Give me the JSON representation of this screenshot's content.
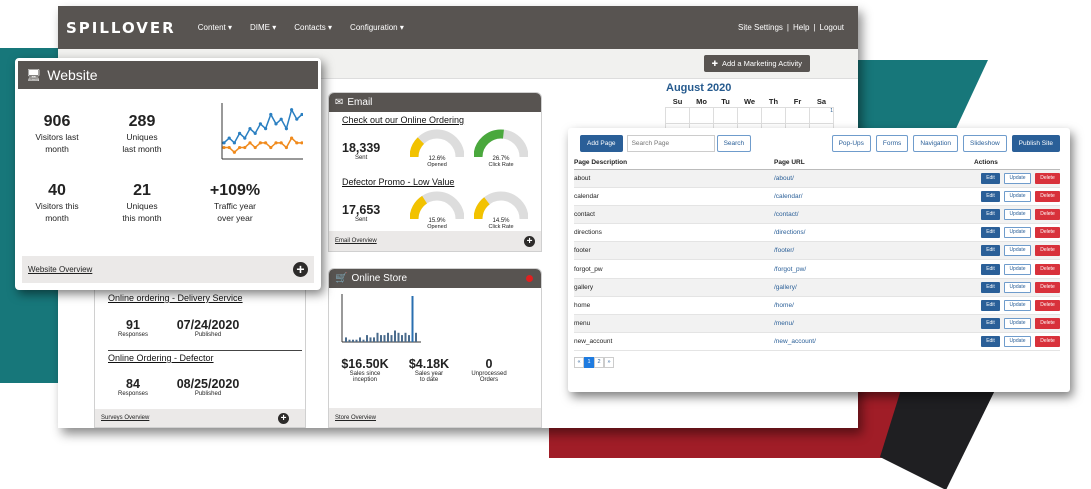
{
  "header": {
    "logo": "SPILLOVER",
    "nav": [
      "Content ▾",
      "DIME ▾",
      "Contacts ▾",
      "Configuration ▾"
    ],
    "right_links": [
      "Site Settings",
      "|",
      "Help",
      "|",
      "Logout"
    ],
    "add_marketing_label": "Add a Marketing Activity"
  },
  "calendar": {
    "title": "August 2020",
    "days": [
      "Su",
      "Mo",
      "Tu",
      "We",
      "Th",
      "Fr",
      "Sa"
    ],
    "first_date": "1"
  },
  "email": {
    "title": "Email",
    "campaigns": [
      {
        "name": "Check out our Online Ordering",
        "sent": "18,339",
        "sent_label": "Sent",
        "opened": "12.6%",
        "opened_label": "Opened",
        "opened_value": 12.6,
        "click": "26.7%",
        "click_label": "Click Rate",
        "click_value": 26.7
      },
      {
        "name": "Defector Promo - Low Value",
        "sent": "17,653",
        "sent_label": "Sent",
        "opened": "15.9%",
        "opened_label": "Opened",
        "opened_value": 15.9,
        "click": "14.5%",
        "click_label": "Click Rate",
        "click_value": 14.5
      }
    ],
    "footer_link": "Email Overview"
  },
  "store": {
    "title": "Online Store",
    "stats": [
      {
        "value": "$16.50K",
        "label1": "Sales since",
        "label2": "inception"
      },
      {
        "value": "$4.18K",
        "label1": "Sales year",
        "label2": "to date"
      },
      {
        "value": "0",
        "label1": "Unprocessed",
        "label2": "Orders"
      }
    ],
    "footer_link": "Store Overview",
    "bars": [
      2,
      1,
      1,
      1,
      2,
      1,
      3,
      2,
      2,
      4,
      3,
      3,
      4,
      3,
      5,
      4,
      3,
      4,
      3,
      20,
      4
    ]
  },
  "surveys": {
    "items": [
      {
        "name": "Online ordering - Delivery Service",
        "responses": "91",
        "responses_label": "Responses",
        "date": "07/24/2020",
        "date_label": "Published"
      },
      {
        "name": "Online Ordering - Defector",
        "responses": "84",
        "responses_label": "Responses",
        "date": "08/25/2020",
        "date_label": "Published"
      }
    ],
    "footer_link": "Surveys Overview"
  },
  "website": {
    "title": "Website",
    "stats": [
      {
        "value": "906",
        "label1": "Visitors last",
        "label2": "month"
      },
      {
        "value": "289",
        "label1": "Uniques",
        "label2": "last month"
      },
      {
        "value": "40",
        "label1": "Visitors this",
        "label2": "month"
      },
      {
        "value": "21",
        "label1": "Uniques",
        "label2": "this month"
      },
      {
        "value": "+109%",
        "label1": "Traffic year",
        "label2": "over year"
      }
    ],
    "footer_link": "Website Overview",
    "colors": {
      "series_a": "#2a7fc1",
      "series_b": "#f08a1c"
    },
    "series_a": [
      3,
      4,
      3,
      5,
      4,
      6,
      5,
      7,
      6,
      9,
      7,
      8,
      6,
      10,
      8,
      9
    ],
    "series_b": [
      2,
      2,
      1,
      2,
      2,
      3,
      2,
      3,
      3,
      2,
      3,
      3,
      2,
      4,
      3,
      3
    ]
  },
  "pages": {
    "add_label": "Add Page",
    "search_placeholder": "Search Page",
    "search_label": "Search",
    "buttons": [
      "Pop-Ups",
      "Forms",
      "Navigation",
      "Slideshow"
    ],
    "publish_label": "Publish Site",
    "columns": [
      "Page Description",
      "Page URL",
      "Actions"
    ],
    "rows": [
      {
        "desc": "about",
        "url": "/about/"
      },
      {
        "desc": "calendar",
        "url": "/calendar/"
      },
      {
        "desc": "contact",
        "url": "/contact/"
      },
      {
        "desc": "directions",
        "url": "/directions/"
      },
      {
        "desc": "footer",
        "url": "/footer/"
      },
      {
        "desc": "forgot_pw",
        "url": "/forgot_pw/"
      },
      {
        "desc": "gallery",
        "url": "/gallery/"
      },
      {
        "desc": "home",
        "url": "/home/"
      },
      {
        "desc": "menu",
        "url": "/menu/"
      },
      {
        "desc": "new_account",
        "url": "/new_account/"
      }
    ],
    "edit_label": "Edit",
    "update_label": "Update",
    "delete_label": "Delete",
    "pager": [
      "«",
      "1",
      "2",
      "»"
    ]
  }
}
